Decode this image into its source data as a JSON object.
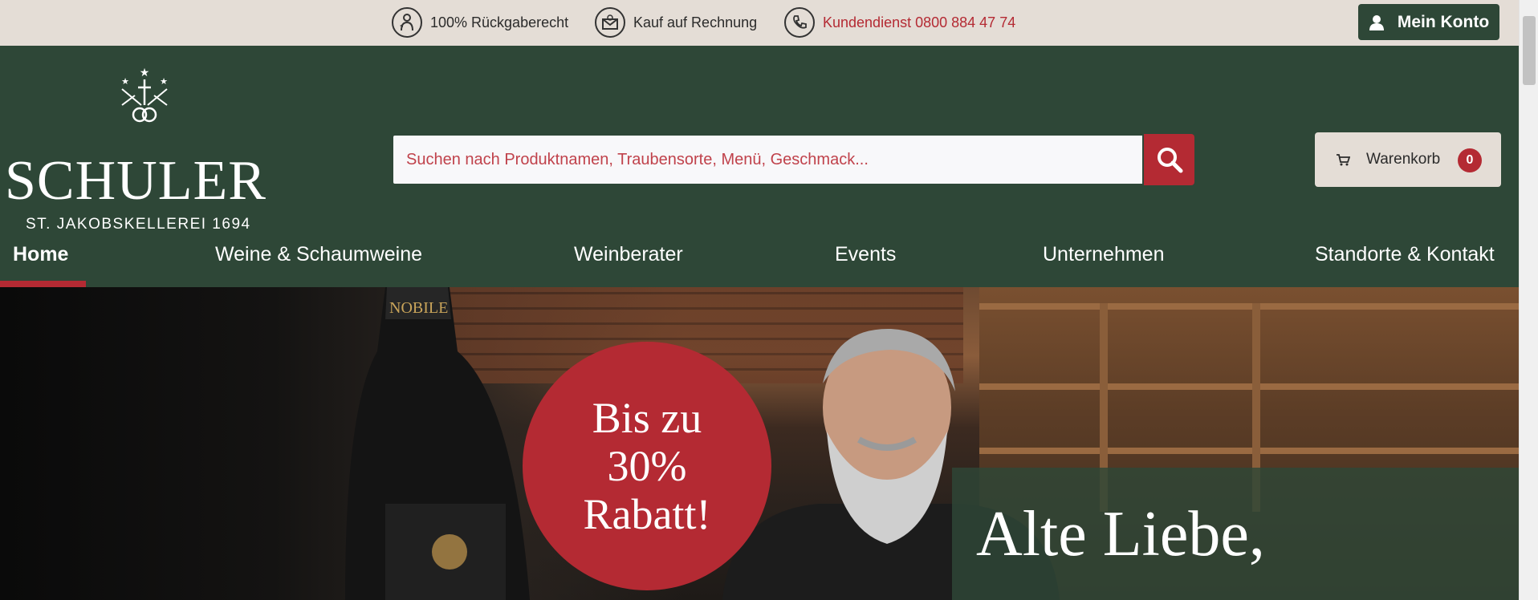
{
  "topbar": {
    "usps": [
      {
        "icon": "return-person-icon",
        "label": "100% Rückgaberecht"
      },
      {
        "icon": "invoice-envelope-icon",
        "label": "Kauf auf Rechnung"
      },
      {
        "icon": "phone-icon",
        "label": "Kundendienst 0800 884 47 74"
      }
    ],
    "account_label": "Mein Konto"
  },
  "logo": {
    "name": "SCHULER",
    "sub": "ST. JAKOBSKELLEREI 1694"
  },
  "search": {
    "placeholder": "Suchen nach Produktnamen, Traubensorte, Menü, Geschmack...",
    "value": ""
  },
  "cart": {
    "label": "Warenkorb",
    "count": "0"
  },
  "nav": {
    "items": [
      {
        "label": "Home",
        "active": true
      },
      {
        "label": "Weine & Schaumweine"
      },
      {
        "label": "Weinberater"
      },
      {
        "label": "Events"
      },
      {
        "label": "Unternehmen"
      },
      {
        "label": "Standorte & Kontakt"
      }
    ]
  },
  "hero": {
    "bottle_label": "NOBILE",
    "promo_line1": "Bis zu",
    "promo_line2": "30%",
    "promo_line3": "Rabatt!",
    "title": "Alte Liebe,"
  },
  "colors": {
    "brand_green": "#2e4737",
    "accent_red": "#b42a33",
    "topbar_beige": "#e4ddd6"
  }
}
